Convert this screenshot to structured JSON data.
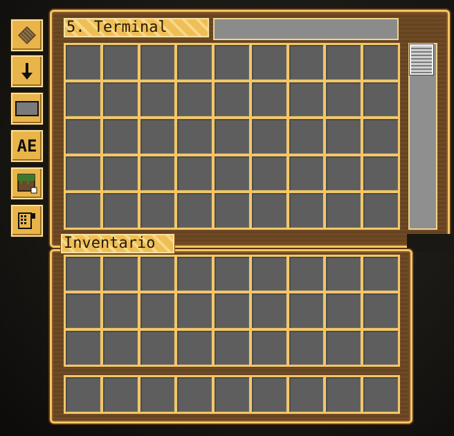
{
  "terminal": {
    "title": "5. Terminal",
    "search_value": ""
  },
  "inventory": {
    "title": "Inventario"
  },
  "side_buttons": [
    {
      "icon": "cells-view-icon"
    },
    {
      "icon": "sort-down-arrow-icon"
    },
    {
      "icon": "terminal-size-icon"
    },
    {
      "icon": "ae-search-mode-icon",
      "text": "AE"
    },
    {
      "icon": "grass-block-icon"
    },
    {
      "icon": "crafting-terminal-icon"
    }
  ],
  "colors": {
    "frame_gold": "#f3c768",
    "wood": "#6b4722",
    "slot": "#5e5e5e"
  }
}
